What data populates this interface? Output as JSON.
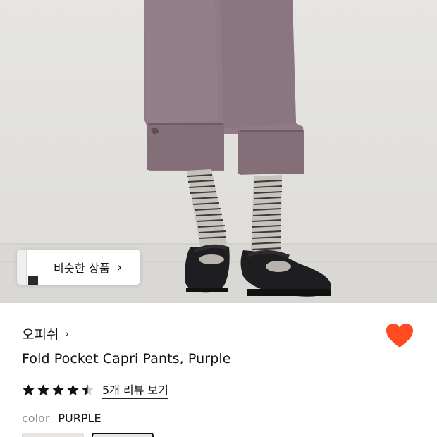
{
  "similar_products": {
    "label": "비슷한 상품",
    "chevron": "›"
  },
  "brand": {
    "name": "오피쉬",
    "chevron": "›"
  },
  "wishlist": {
    "icon": "heart-icon",
    "active": true,
    "color": "#ff4b1f"
  },
  "product": {
    "title": "Fold Pocket Capri Pants, Purple"
  },
  "rating": {
    "value": 4.5,
    "max": 5,
    "review_link": "5개 리뷰 보기",
    "star_color": "#111111"
  },
  "option": {
    "label": "color",
    "value": "PURPLE",
    "swatches": [
      "swatch-1",
      "swatch-2"
    ],
    "selected_index": 1
  }
}
